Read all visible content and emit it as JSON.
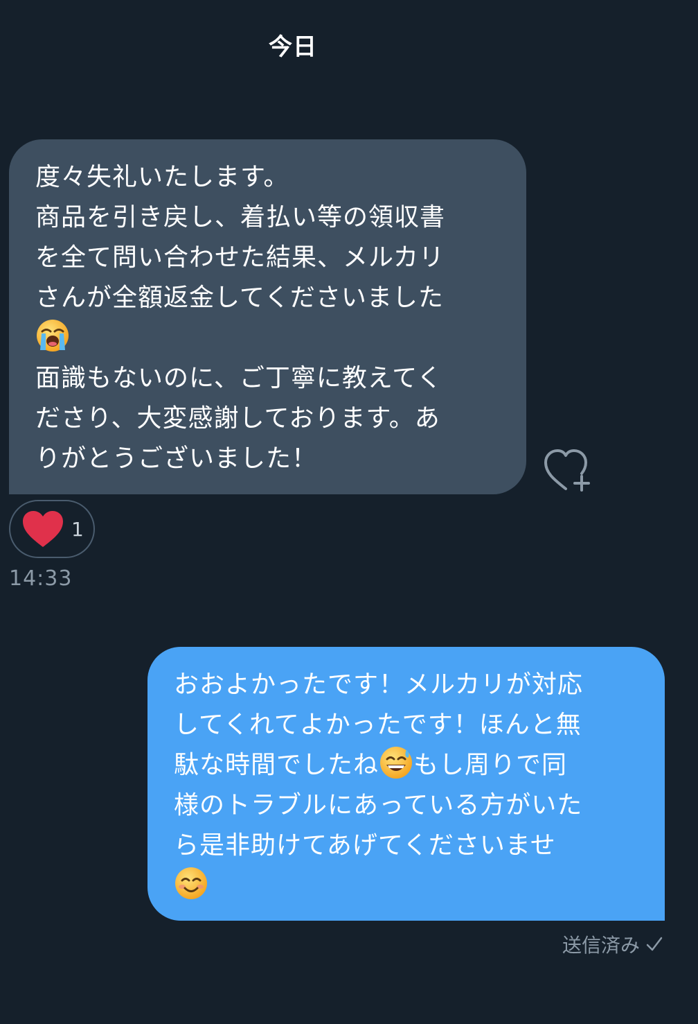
{
  "header": {
    "date_label": "今日"
  },
  "incoming": {
    "lines": [
      "度々失礼いたします。",
      "商品を引き戻し、着払い等の領収書",
      "を全て問い合わせた結果、メルカリ",
      "さんが全額返金してくださいました",
      "",
      "面識もないのに、ご丁寧に教えてく",
      "ださり、大変感謝しております。あ",
      "りがとうございました！"
    ],
    "emoji_icon": "loudly-crying-face-icon",
    "reaction": {
      "icon": "heart-icon",
      "count": "1",
      "color": "#e0314b"
    },
    "timestamp": "14:33"
  },
  "outgoing": {
    "line1": "おおよかったです！メルカリが対応",
    "line2": "してくれてよかったです！ほんと無",
    "line3a": "駄な時間でしたね",
    "line3b": "もし周りで同",
    "line4": "様のトラブルにあっている方がいた",
    "line5": "ら是非助けてあげてくださいませ",
    "emoji_icons": [
      "grinning-sweat-face-icon",
      "smiling-face-icon"
    ],
    "status": "送信済み"
  },
  "colors": {
    "background": "#15202b",
    "incoming_bubble": "#3e4f60",
    "outgoing_bubble": "#4aa3f5",
    "muted_text": "#8c9aa7"
  }
}
